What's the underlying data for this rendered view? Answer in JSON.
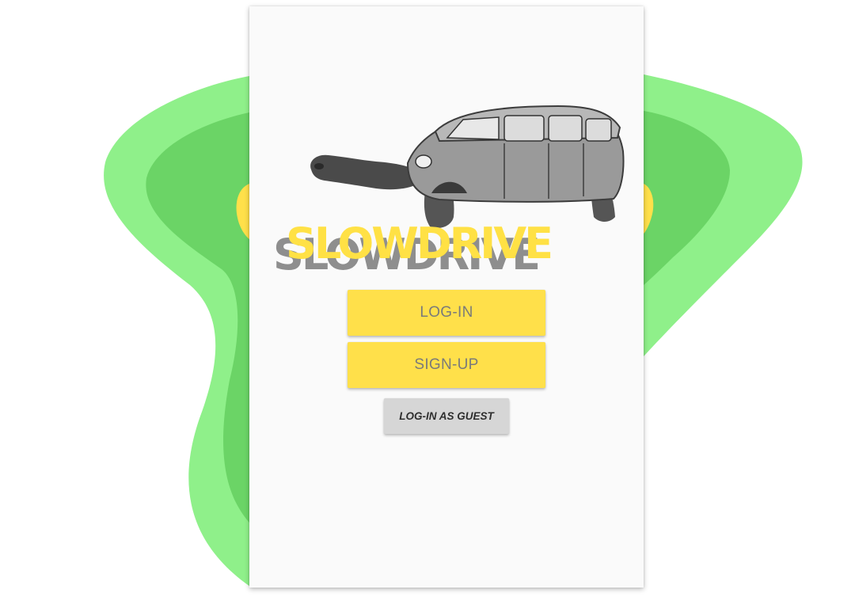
{
  "app": {
    "logo_text": "SLOWDRIVE"
  },
  "buttons": {
    "login_label": "LOG-IN",
    "signup_label": "SIGN-UP",
    "guest_label": "LOG-IN AS GUEST"
  },
  "colors": {
    "background_blob_light": "#8ff08a",
    "background_blob_mid": "#6bd466",
    "background_blob_dark": "#5cc05a",
    "accent_yellow": "#ffe04a",
    "guest_button": "#d6d6d6",
    "phone_background": "#fafafa"
  },
  "hero": {
    "icon": "turtle-car-illustration"
  }
}
